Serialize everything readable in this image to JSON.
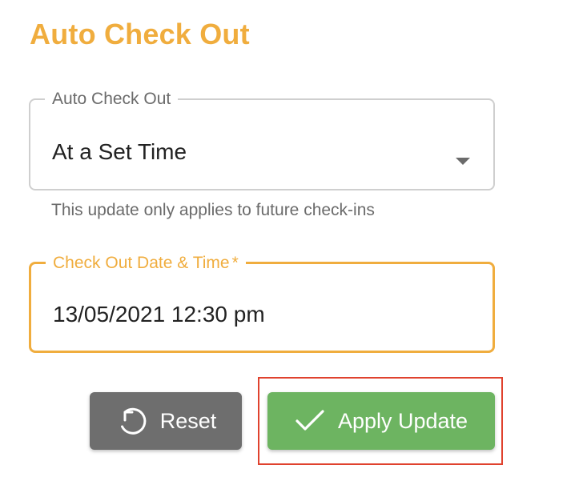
{
  "page": {
    "title": "Auto Check Out"
  },
  "auto_checkout_select": {
    "label": "Auto Check Out",
    "value": "At a Set Time",
    "helper_text": "This update only applies to future check-ins"
  },
  "checkout_datetime": {
    "label": "Check Out Date & Time",
    "required_mark": "*",
    "value": "13/05/2021 12:30 pm"
  },
  "buttons": {
    "reset_label": "Reset",
    "apply_label": "Apply Update"
  },
  "colors": {
    "accent": "#f0ad3e",
    "reset_button": "#6e6e6e",
    "apply_button": "#6db461",
    "highlight_outline": "#e0422e"
  },
  "icons": {
    "reset": "undo-icon",
    "apply": "check-icon",
    "select": "caret-down-icon"
  }
}
